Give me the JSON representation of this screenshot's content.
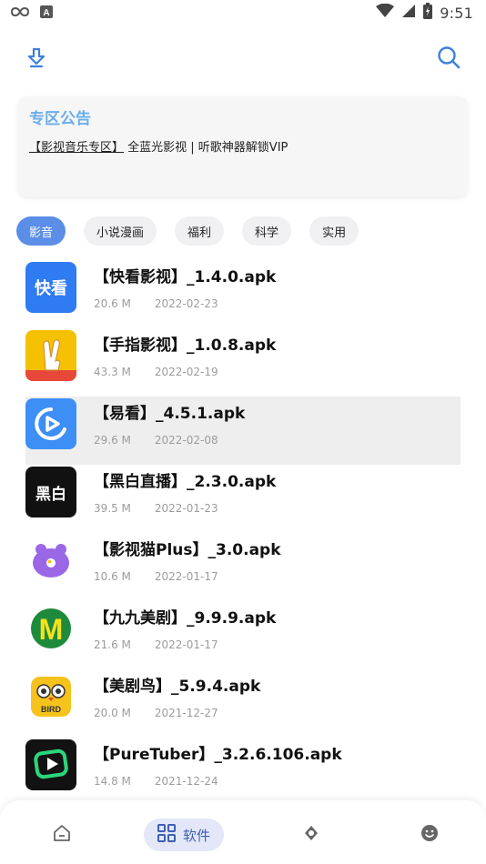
{
  "status_bar": {
    "time": "9:51",
    "left_icons": [
      "infinity-icon",
      "a-box-icon"
    ],
    "right_icons": [
      "wifi-icon",
      "signal-icon",
      "battery-icon"
    ]
  },
  "top_bar": {
    "left_icon": "download-icon",
    "right_icon": "search-icon"
  },
  "notice": {
    "title": "专区公告",
    "link_text": "【影视音乐专区】",
    "body_text": "全蓝光影视 | 听歌神器解锁VIP"
  },
  "tabs": [
    {
      "label": "影音",
      "active": true
    },
    {
      "label": "小说漫画",
      "active": false
    },
    {
      "label": "福利",
      "active": false
    },
    {
      "label": "科学",
      "active": false
    },
    {
      "label": "实用",
      "active": false
    }
  ],
  "apps": [
    {
      "title": "【快看影视】_1.4.0.apk",
      "size": "20.6 M",
      "date": "2022-02-23",
      "icon_text": "快看",
      "icon_color": "#2f7bf2"
    },
    {
      "title": "【手指影视】_1.0.8.apk",
      "size": "43.3 M",
      "date": "2022-02-19",
      "icon_text": "",
      "icon_color": "#f5c000"
    },
    {
      "title": "【易看】_4.5.1.apk",
      "size": "29.6 M",
      "date": "2022-02-08",
      "icon_text": "",
      "icon_color": "#3d8ef5"
    },
    {
      "title": "【黑白直播】_2.3.0.apk",
      "size": "39.5 M",
      "date": "2022-01-23",
      "icon_text": "黑白",
      "icon_color": "#111111"
    },
    {
      "title": "【影视猫Plus】_3.0.apk",
      "size": "10.6 M",
      "date": "2022-01-17",
      "icon_text": "",
      "icon_color": "#9a68e6"
    },
    {
      "title": "【九九美剧】_9.9.9.apk",
      "size": "21.6 M",
      "date": "2022-01-17",
      "icon_text": "M",
      "icon_color": "#1e8a3c"
    },
    {
      "title": "【美剧鸟】_5.9.4.apk",
      "size": "20.0 M",
      "date": "2021-12-27",
      "icon_text": "BIRD",
      "icon_color": "#f6c21c"
    },
    {
      "title": "【PureTuber】_3.2.6.106.apk",
      "size": "14.8 M",
      "date": "2021-12-24",
      "icon_text": "",
      "icon_color": "#121212"
    }
  ],
  "bottom_nav": {
    "items": [
      {
        "icon": "home-icon",
        "label": ""
      },
      {
        "icon": "grid-icon",
        "label": "软件"
      },
      {
        "icon": "compass-icon",
        "label": ""
      },
      {
        "icon": "smile-icon",
        "label": ""
      }
    ]
  }
}
